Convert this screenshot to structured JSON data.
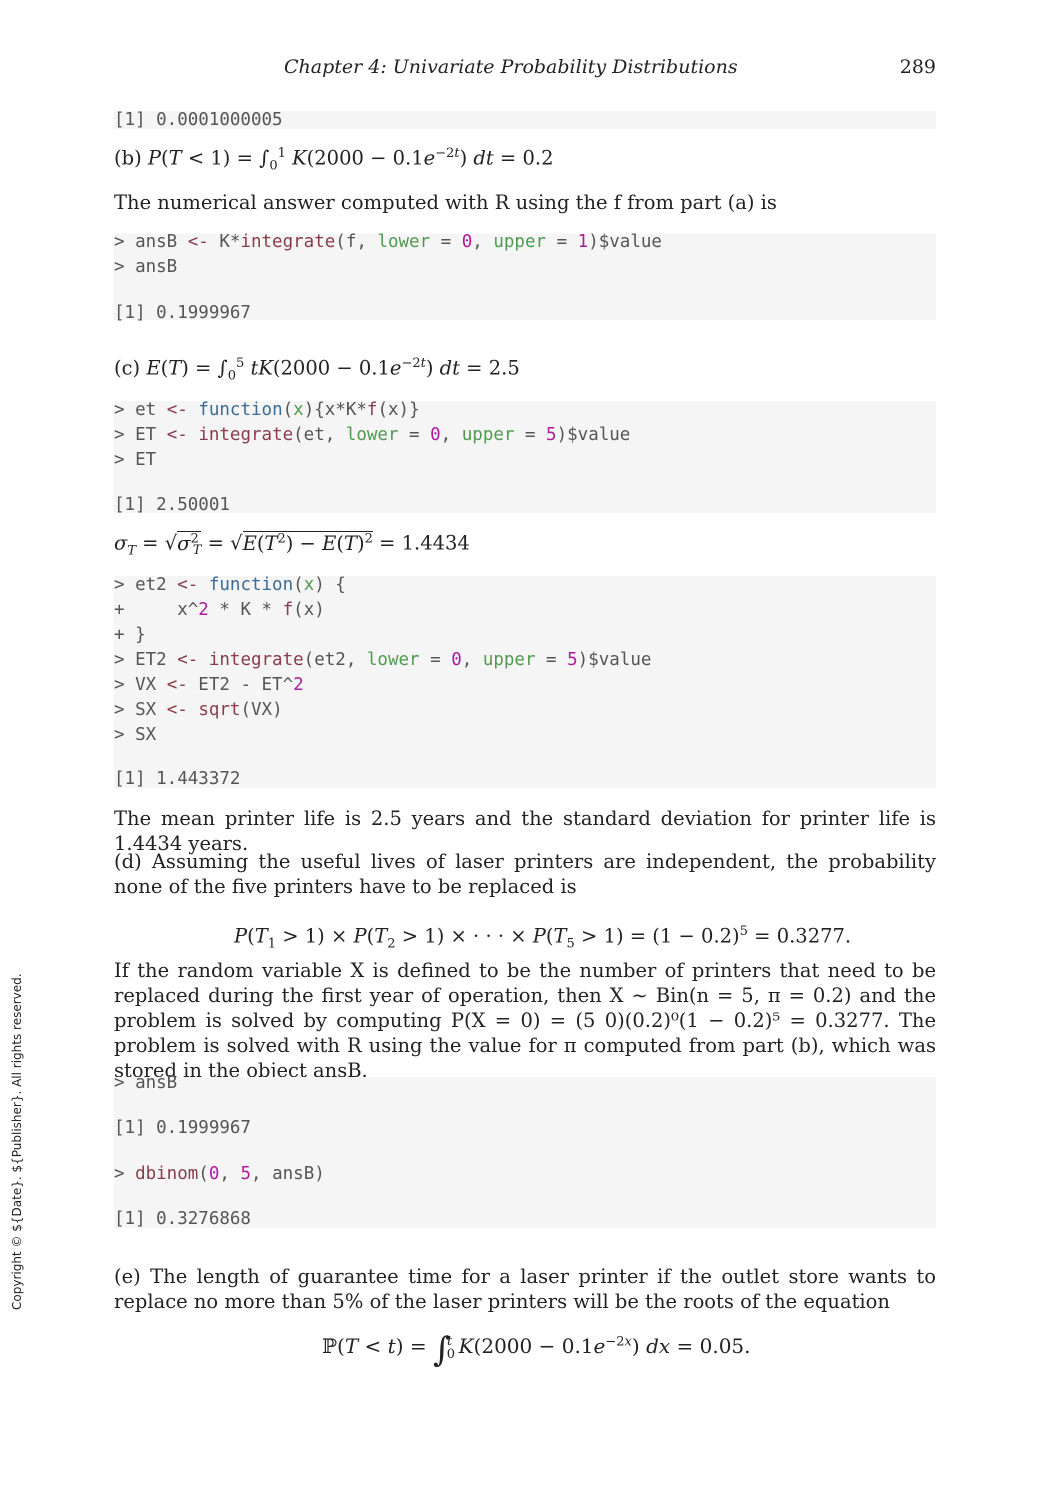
{
  "header": {
    "title": "Chapter  4:   Univariate Probability Distributions",
    "page_number": "289"
  },
  "side_copyright": "Copyright © ${Date}. ${Publisher}. All rights reserved.",
  "blocks": {
    "out_a": "[1] 0.0001000005",
    "b_label": "(b)",
    "b_eq": "P(T < 1) = ∫₀¹ K(2000 − 0.1e^(−2t)) dt = 0.2",
    "b_text": "The numerical answer computed with R using the f from part (a) is",
    "code_b": [
      "> ansB <- K*integrate(f, lower = 0, upper = 1)$value",
      "> ansB",
      "",
      "[1] 0.1999967"
    ],
    "c_eq": "(c) E(T) = ∫₀⁵ tK(2000 − 0.1e^(−2t)) dt = 2.5",
    "code_c": [
      "> et <- function(x){x*K*f(x)}",
      "> ET <- integrate(et, lower = 0, upper = 5)$value",
      "> ET",
      "",
      "[1] 2.50001"
    ],
    "sigma_eq": "σT = √σT² = √E(T²) − E(T)² = 1.4434",
    "code_sigma": [
      "> et2 <- function(x) {",
      "+     x^2 * K * f(x)",
      "+ }",
      "> ET2 <- integrate(et2, lower = 0, upper = 5)$value",
      "> VX <- ET2 - ET^2",
      "> SX <- sqrt(VX)",
      "> SX",
      "",
      "[1] 1.443372"
    ],
    "mean_text": "The mean printer life is 2.5 years and the standard deviation for printer life is 1.4434 years.",
    "d_text": "(d) Assuming the useful lives of laser printers are independent, the probability none of the five printers have to be replaced is",
    "d_eq": "P(T₁ > 1) × P(T₂ > 1) × · · · × P(T₅ > 1) = (1 − 0.2)⁵ = 0.3277.",
    "binom_text": "If the random variable X is defined to be the number of printers that need to be replaced during the first year of operation, then X ∼ Bin(n = 5, π = 0.2) and the problem is solved by computing P(X = 0) = (5 0)(0.2)⁰(1 − 0.2)⁵ = 0.3277. The problem is solved with R using the value for π computed from part (b), which was stored in the object ansB.",
    "code_d": [
      "> ansB",
      "",
      "[1] 0.1999967",
      "",
      "> dbinom(0, 5, ansB)",
      "",
      "[1] 0.3276868"
    ],
    "e_text": "(e) The length of guarantee time for a laser printer if the outlet store wants to replace no more than 5% of the laser printers will be the roots of the equation",
    "e_eq": "ℙ(T < t) = ∫₀ᵗ K(2000 − 0.1e^(−2x)) dx = 0.05."
  }
}
